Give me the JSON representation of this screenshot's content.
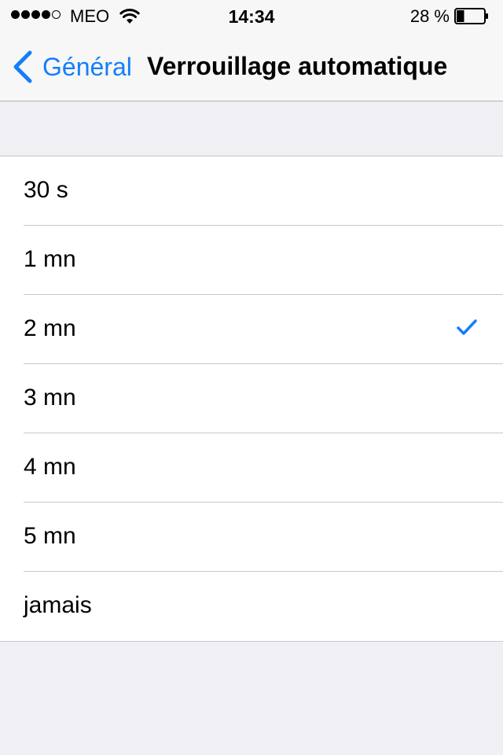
{
  "status_bar": {
    "signal_bars": 4,
    "signal_total": 5,
    "carrier": "MEO",
    "time": "14:34",
    "battery_percent": "28 %",
    "battery_level": 0.28
  },
  "nav": {
    "back_label": "Général",
    "title": "Verrouillage automatique"
  },
  "options": [
    {
      "label": "30 s",
      "selected": false
    },
    {
      "label": "1 mn",
      "selected": false
    },
    {
      "label": "2 mn",
      "selected": true
    },
    {
      "label": "3 mn",
      "selected": false
    },
    {
      "label": "4 mn",
      "selected": false
    },
    {
      "label": "5 mn",
      "selected": false
    },
    {
      "label": "jamais",
      "selected": false
    }
  ],
  "colors": {
    "accent": "#147efb",
    "background": "#efeff4",
    "bar": "#f7f7f7"
  },
  "icons": {
    "signal": "signal-dots-icon",
    "wifi": "wifi-icon",
    "battery": "battery-icon",
    "back": "chevron-left-icon",
    "selected": "checkmark-icon"
  }
}
